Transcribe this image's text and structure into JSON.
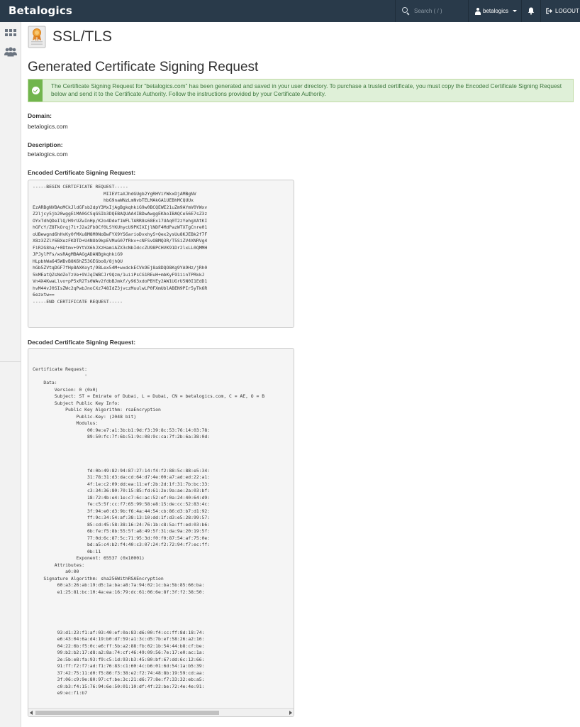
{
  "topbar": {
    "brand": "Betalogics",
    "search_placeholder": "Search ( / )",
    "username": "betalogics",
    "logout_label": "LOGOUT",
    "bg_color": "#293a4a"
  },
  "sidebar": {
    "icons": [
      "grid-icon",
      "users-icon"
    ]
  },
  "page": {
    "title": "SSL/TLS",
    "heading": "Generated Certificate Signing Request"
  },
  "alert": {
    "text": "The Certificate Signing Request for “betalogics.com” has been generated and saved in your user directory. To purchase a trusted certificate, you must copy the Encoded Certificate Signing Request below and send it to the Certificate Authority. Follow the instructions provided by your Certificate Authority.",
    "color": "#71b54d"
  },
  "domain": {
    "label": "Domain:",
    "value": "betalogics.com"
  },
  "description": {
    "label": "Description:",
    "value": "betalogics.com"
  },
  "encoded": {
    "label": "Encoded Certificate Signing Request:",
    "text": "-----BEGIN CERTIFICATE REQUEST-----\n                          MIIEVtaXJhdGUgb2YgRHViYWkxDjAMBgNV\n                          hbG9naWNzLmNvbTELMAkGA1UEBhMCQUUx\nEzARBgNVBAoMCkJldGFsb2dpY3MxIjAgBgkqhkiG9w0BCQEWE21uZm9AYmV0YWxv\nZ2ljcy5jb20wggEiMA0GCSqGSIb3DQEBAQUAA4IBDwAwggEKAoIBAQCe56E7sZ3z\nOYxTdhQDeIlQ/H9rUZwInHp/K2o4Ddef1WFLTARR8s68Ex17UAq0T2zYehgXAtKI\nhGFcY/Z8TkOrqj7i+J2a2FbOCf0LSYKUhycU9PKIXIjlNDF4MdPazWTXTgCnre01\noUBewgnd6hHvKy0fMXu8M8M0NoBwFYX9YS6arioDvxhyS+Qex2ysUu8KJEBk2f7F\nX8z3ZZlY6BXezFKDTD+U4NOb9kpEVMuG07fRkv+cNFSvOBMQ3R/T5SiZV4XNRVg4\nFiR2G8ha/+0Dtmv+9YtVX6hJXzHamiAZX3cNbIdccZU98PCHVK91Dr2lxLL0QMMH\nJPJylPFs/wsRAgMBAAGgADANBgkqhkiG9\nHLpbhWa645WBvB8K6hZ53GEGbo8/8jhQU\nhGb5ZVtqDGF7fHp8AXKoyt/98Lex54M+wxdckECVk9Ej8a8DQO8Kg9YA9Hz/jRh0\n5kMEatQZsNdZoTzVe+9VJqIWBCJr9Qzm/1uiiPsCG1REuH+mbKyF91iinTPRkkJ\nVn4X4KwaLlvo+pP5xR2Ts0WAv2fdbBJmkf/y963xdoPBYEy2AW1UGrU5N0I1EdD1\nhvM44vJ0SIsZWc2qPwbJnoCXz748IdZ3jvczMuulwLP0FXmUblABEN9PIr5yTk6R\n6ezxtw==\n-----END CERTIFICATE REQUEST-----"
  },
  "decoded": {
    "label": "Decoded Certificate Signing Request:",
    "text": "Certificate Request:\n                   '\n    Data:\n        Version: 0 (0x0)\n        Subject: ST = Emirate of Dubai, L = Dubai, CN = betalogics.com, C = AE, O = B\n        Subject Public Key Info:\n            Public Key Algorithm: rsaEncryption\n                Public-Key: (2048 bit)\n                Modulus:\n                    00:9e:e7:a1:3b:b1:9d:f3:39:8c:53:76:14:03:78:\n                    89:50:fc:7f:6b:51:9c:08:9c:ca:7f:2b:6a:38:0d:\n\n\n\n\n                    fd:0b:49:82:94:87:27:14:f4:f2:88:5c:88:e5:34:\n                    31:78:31:d3:da:cd:64:d7:4e:00:a7:ad:ed:22:a1:\n                    4f:1e:c2:09:dd:ea:11:ef:2b:2d:1f:31:7b:bc:33:\n                    c3:34:36:80:70:15:85:fd:61:2e:9a:ae:2a:03:bf:\n                    18:72:4b:e4:1e:c7:6c:ac:52:ef:0a:24:40:64:d9:\n                    fe:c5:5f:cc:f7:65:99:58:e8:15:de:cc:52:83:4c:\n                    3f:94:e0:d3:9b:f6:4a:44:54:cb:86:d3:b7:d1:92:\n                    ff:9c:34:54:af:38:13:10:dd:1f:d3:e5:28:99:57:\n                    85:cd:45:58:38:16:24:76:1b:c8:5a:ff:ed:03:b6:\n                    6b:fe:f5:8b:55:5f:a8:49:5f:31:da:9a:20:19:5f:\n                    77:0d:6c:87:5c:71:95:3d:f0:f0:87:54:af:75:0e:\n                    bd:a5:c4:b2:f4:40:c3:07:24:f2:72:94:f7:ec:ff:\n                    0b:11\n                Exponent: 65537 (0x10001)\n        Attributes:\n            a0:00\n    Signature Algorithm: sha256WithRSAEncryption\n         60:a3:26:ab:19:d5:1a:ba:a8:7a:94:02:1c:ba:5b:85:66:ba:\n         e1:25:81:bc:10:4a:ea:16:79:dc:61:06:6e:8f:3f:f2:38:50:\n\n\n\n\n\n         93:d1:23:f1:af:03:40:ef:0a:83:d6:00:f4:cc:ff:8d:18:74:\n         e6:43:04:6a:d4:19:b0:d7:59:a1:3c:d5:7b:ef:58:26:a2:16:\n         04:22:6b:f5:0c:e6:ff:5b:a2:88:fb:02:1b:54:44:b8:cf:be:\n         99:b2:b2:17:d8:a2:8a:74:cf:46:49:09:56:7e:17:e0:ac:1a:\n         2e:5b:e8:fa:93:f9:c5:1d:93:b3:45:80:bf:67:dd:6c:12:66:\n         91:ff:f2:f7:ad:f1:76:83:c1:60:4c:b6:01:6d:54:1a:b5:39:\n         37:42:75:11:d0:f5:86:f3:38:e2:f2:74:48:8b:19:59:cd:aa:\n         3f:06:c9:9e:80:97:cf:be:3c:21:d6:77:8e:f7:33:32:eb:a5:\n         c0:b3:f4:15:76:94:6e:50:01:10:df:4f:22:be:72:4e:4e:91:\n         e9:ec:f1:b7"
  }
}
